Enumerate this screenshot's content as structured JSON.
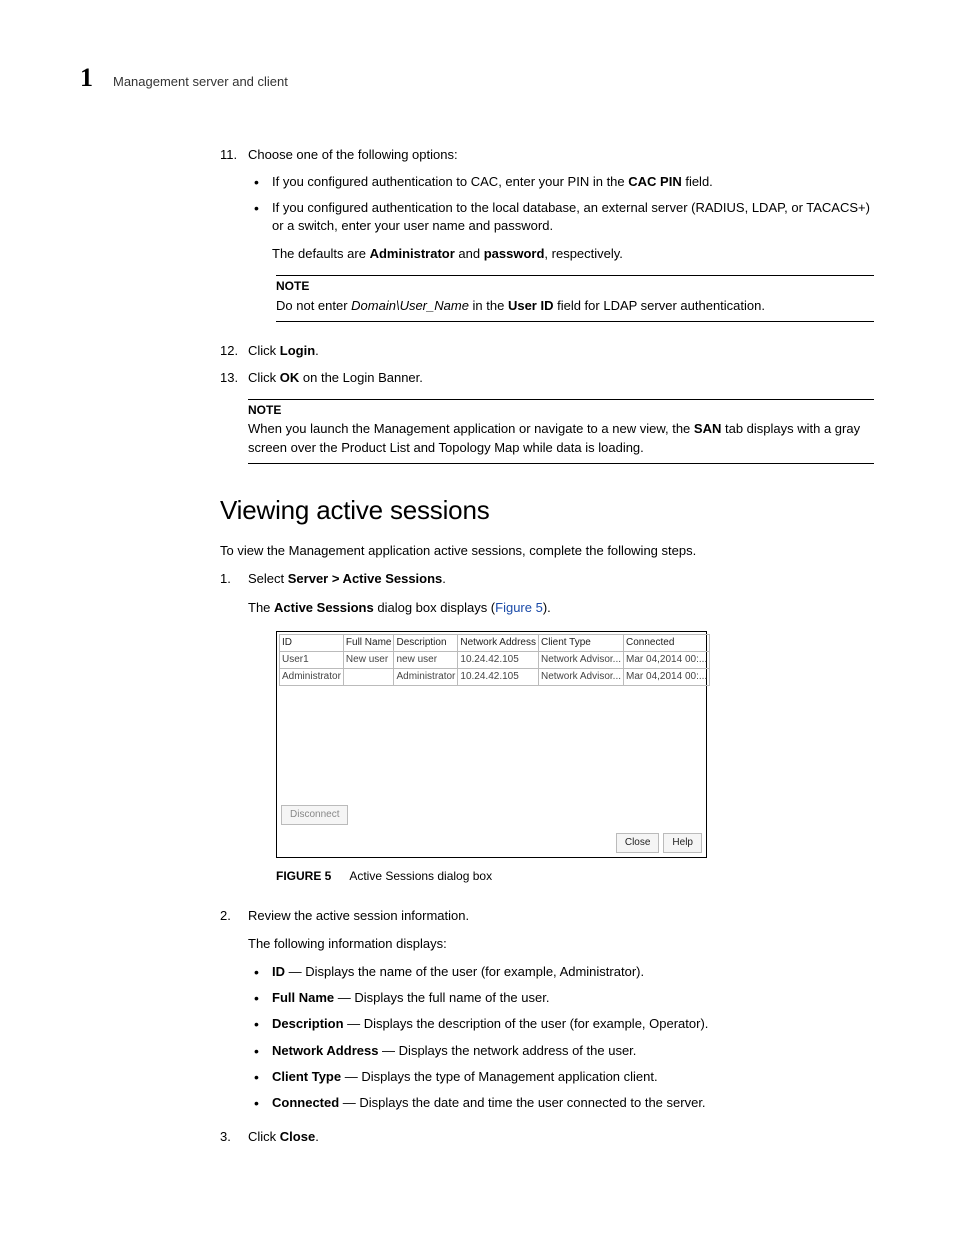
{
  "header": {
    "chapter_num": "1",
    "chapter_name": "Management server and client"
  },
  "steps": {
    "s11": {
      "num": "11.",
      "lead": "Choose one of the following options:",
      "bul_a_pre": "If you configured authentication to CAC, enter your PIN in the ",
      "bul_a_bold": "CAC PIN",
      "bul_a_post": " field.",
      "bul_b": "If you configured authentication to the local database, an external server (RADIUS, LDAP, or TACACS+) or a switch, enter your user name and password.",
      "defaults_pre": "The defaults are ",
      "defaults_b1": "Administrator",
      "defaults_mid": " and ",
      "defaults_b2": "password",
      "defaults_post": ", respectively.",
      "note_title": "NOTE",
      "note_pre": "Do not enter ",
      "note_em": "Domain\\User_Name",
      "note_mid": " in the ",
      "note_bold": "User ID",
      "note_post": " field for LDAP server authentication."
    },
    "s12": {
      "num": "12.",
      "pre": "Click ",
      "b": "Login",
      "post": "."
    },
    "s13": {
      "num": "13.",
      "pre": "Click ",
      "b": "OK",
      "post": " on the Login Banner."
    },
    "note2": {
      "title": "NOTE",
      "pre": "When you launch the Management application or navigate to a new view, the ",
      "b": "SAN",
      "post": " tab displays with a gray screen over the Product List and Topology Map while data is loading."
    }
  },
  "section": {
    "title": "Viewing active sessions",
    "intro": "To view the Management application active sessions, complete the following steps.",
    "s1": {
      "num": "1.",
      "pre": "Select ",
      "b": "Server > Active Sessions",
      "post": ".",
      "p2_pre": "The ",
      "p2_b": "Active Sessions",
      "p2_mid": " dialog box displays (",
      "p2_link": "Figure 5",
      "p2_post": ")."
    },
    "figcap": {
      "fign": "FIGURE 5",
      "txt": "Active Sessions dialog box"
    },
    "s2": {
      "num": "2.",
      "lead": "Review the active session information.",
      "sub": "The following information displays:",
      "items": {
        "i1b": "ID",
        "i1t": " — Displays the name of the user (for example, Administrator).",
        "i2b": "Full Name",
        "i2t": " — Displays the full name of the user.",
        "i3b": "Description",
        "i3t": " — Displays the description of the user (for example, Operator).",
        "i4b": "Network Address",
        "i4t": " — Displays the network address of the user.",
        "i5b": "Client Type",
        "i5t": " — Displays the type of Management application client.",
        "i6b": "Connected",
        "i6t": " — Displays the date and time the user connected to the server."
      }
    },
    "s3": {
      "num": "3.",
      "pre": "Click ",
      "b": "Close",
      "post": "."
    }
  },
  "dialog": {
    "headers": [
      "ID",
      "Full Name",
      "Description",
      "Network Address",
      "Client Type",
      "Connected"
    ],
    "rows": [
      [
        "User1",
        "New user",
        "new user",
        "10.24.42.105",
        "Network Advisor...",
        "Mar 04,2014 00:..."
      ],
      [
        "Administrator",
        "",
        "Administrator",
        "10.24.42.105",
        "Network Advisor...",
        "Mar 04,2014 00:..."
      ]
    ],
    "btn_disconnect": "Disconnect",
    "btn_close": "Close",
    "btn_help": "Help"
  }
}
